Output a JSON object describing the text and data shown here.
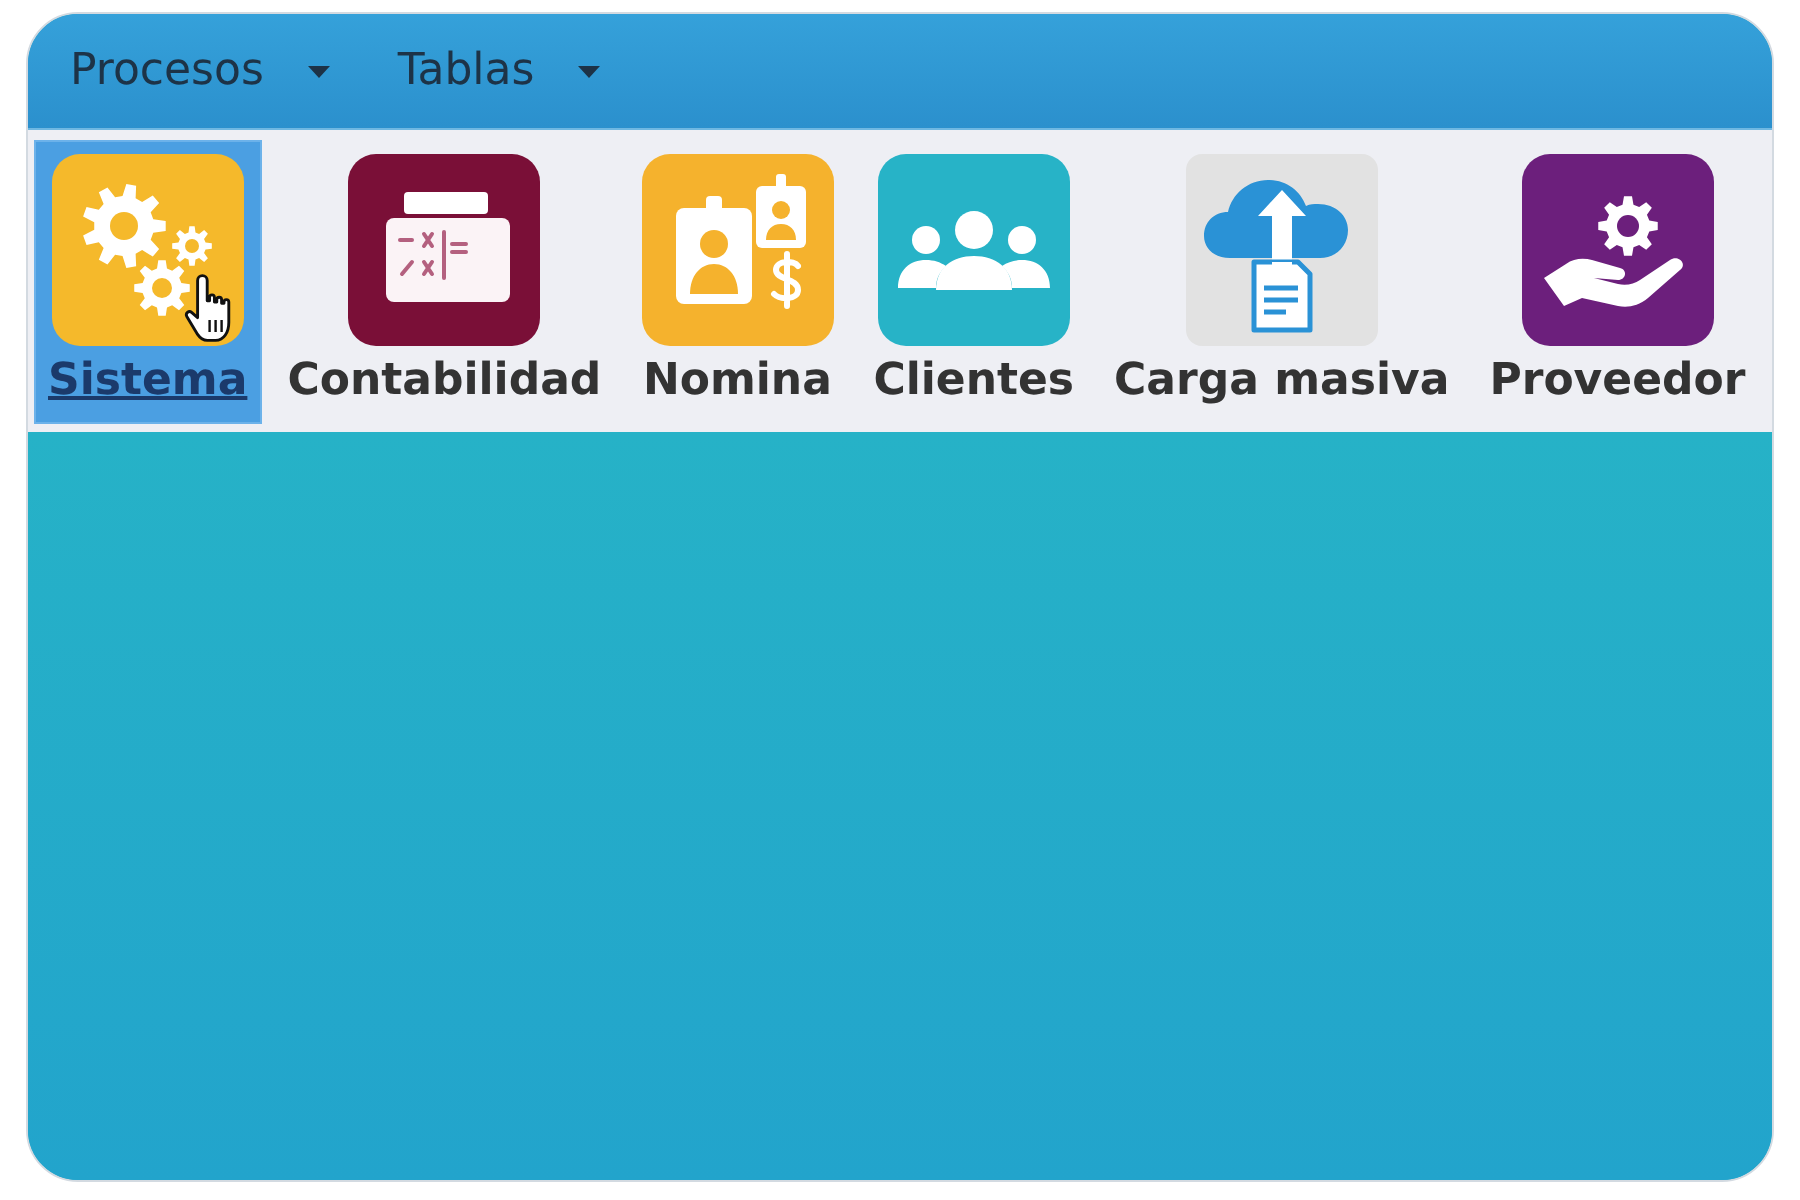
{
  "menu_bar": {
    "items": [
      {
        "label": "Procesos"
      },
      {
        "label": "Tablas"
      }
    ]
  },
  "toolbar": {
    "items": [
      {
        "label": "Sistema",
        "kind": "gears",
        "color": "#f5b92b",
        "selected": true
      },
      {
        "label": "Contabilidad",
        "kind": "calculator",
        "color": "#7a0f37",
        "selected": false
      },
      {
        "label": "Nomina",
        "kind": "payroll",
        "color": "#f5b22d",
        "selected": false
      },
      {
        "label": "Clientes",
        "kind": "people",
        "color": "#27b3c7",
        "selected": false
      },
      {
        "label": "Carga masiva",
        "kind": "upload",
        "color": "#e2e2e2",
        "selected": false
      },
      {
        "label": "Proveedor",
        "kind": "supplier",
        "color": "#6c1f7c",
        "selected": false
      }
    ]
  }
}
